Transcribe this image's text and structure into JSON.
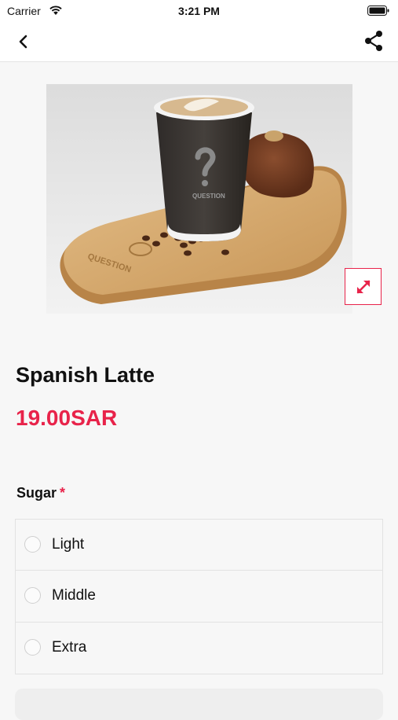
{
  "status_bar": {
    "carrier": "Carrier",
    "time": "3:21 PM",
    "wifi_icon": "wifi-icon",
    "battery_icon": "battery-icon"
  },
  "nav": {
    "back_icon": "chevron-left-icon",
    "share_icon": "share-icon"
  },
  "product": {
    "name": "Spanish Latte",
    "price": "19.00SAR",
    "image": "coffee-cup-with-chocolate-cake-on-wooden-tray",
    "cup_brand": "QUESTION",
    "expand_icon": "expand-diagonal-icon"
  },
  "options_section": {
    "title": "Sugar",
    "required_marker": "*",
    "choices": [
      {
        "label": "Light"
      },
      {
        "label": "Middle"
      },
      {
        "label": "Extra"
      }
    ]
  },
  "colors": {
    "accent": "#e8234a",
    "background": "#f7f7f7",
    "text": "#111111"
  }
}
